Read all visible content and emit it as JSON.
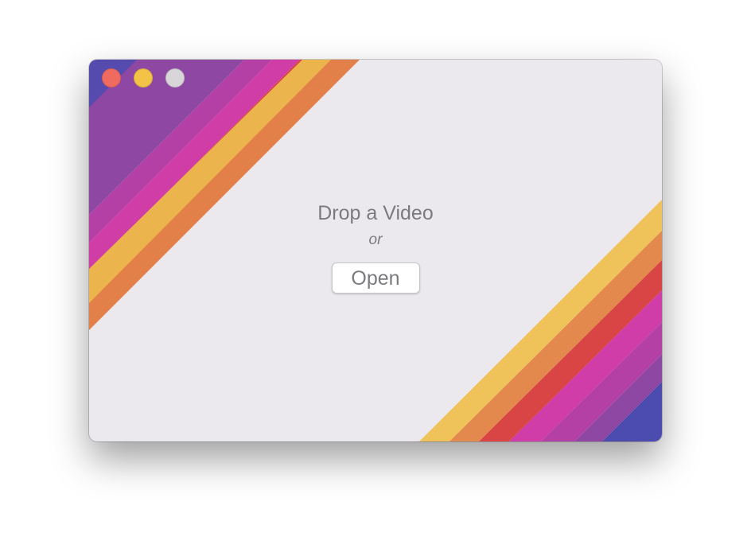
{
  "window": {
    "controls": [
      {
        "name": "close",
        "color": "#ef6b5f"
      },
      {
        "name": "minimize",
        "color": "#f3c348"
      },
      {
        "name": "zoom",
        "color": "#d8d6d8"
      }
    ]
  },
  "main": {
    "prompt": "Drop a Video",
    "separator": "or",
    "open_button_label": "Open"
  },
  "decoration": {
    "stripe_colors": [
      "#4b4bb0",
      "#8e47a3",
      "#b440a6",
      "#d13da7",
      "#d94242",
      "#e3804a",
      "#efb24a"
    ]
  }
}
